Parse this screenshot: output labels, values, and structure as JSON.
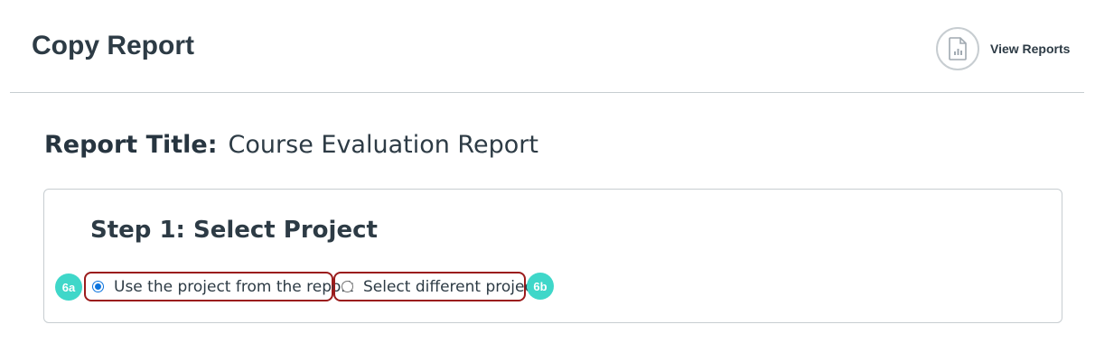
{
  "header": {
    "title": "Copy Report",
    "view_reports_label": "View Reports",
    "view_reports_icon": "report-document-icon"
  },
  "report": {
    "title_label": "Report Title:",
    "title_value": "Course Evaluation Report"
  },
  "step1": {
    "title": "Step 1: Select Project",
    "options": [
      {
        "label": "Use the project from the report",
        "checked": true,
        "badge": "6a"
      },
      {
        "label": "Select different project",
        "checked": false,
        "badge": "6b"
      }
    ]
  },
  "colors": {
    "annotation_outline": "#9b1c1c",
    "badge": "#3fd7c9",
    "radio_selected": "#0b74de"
  }
}
